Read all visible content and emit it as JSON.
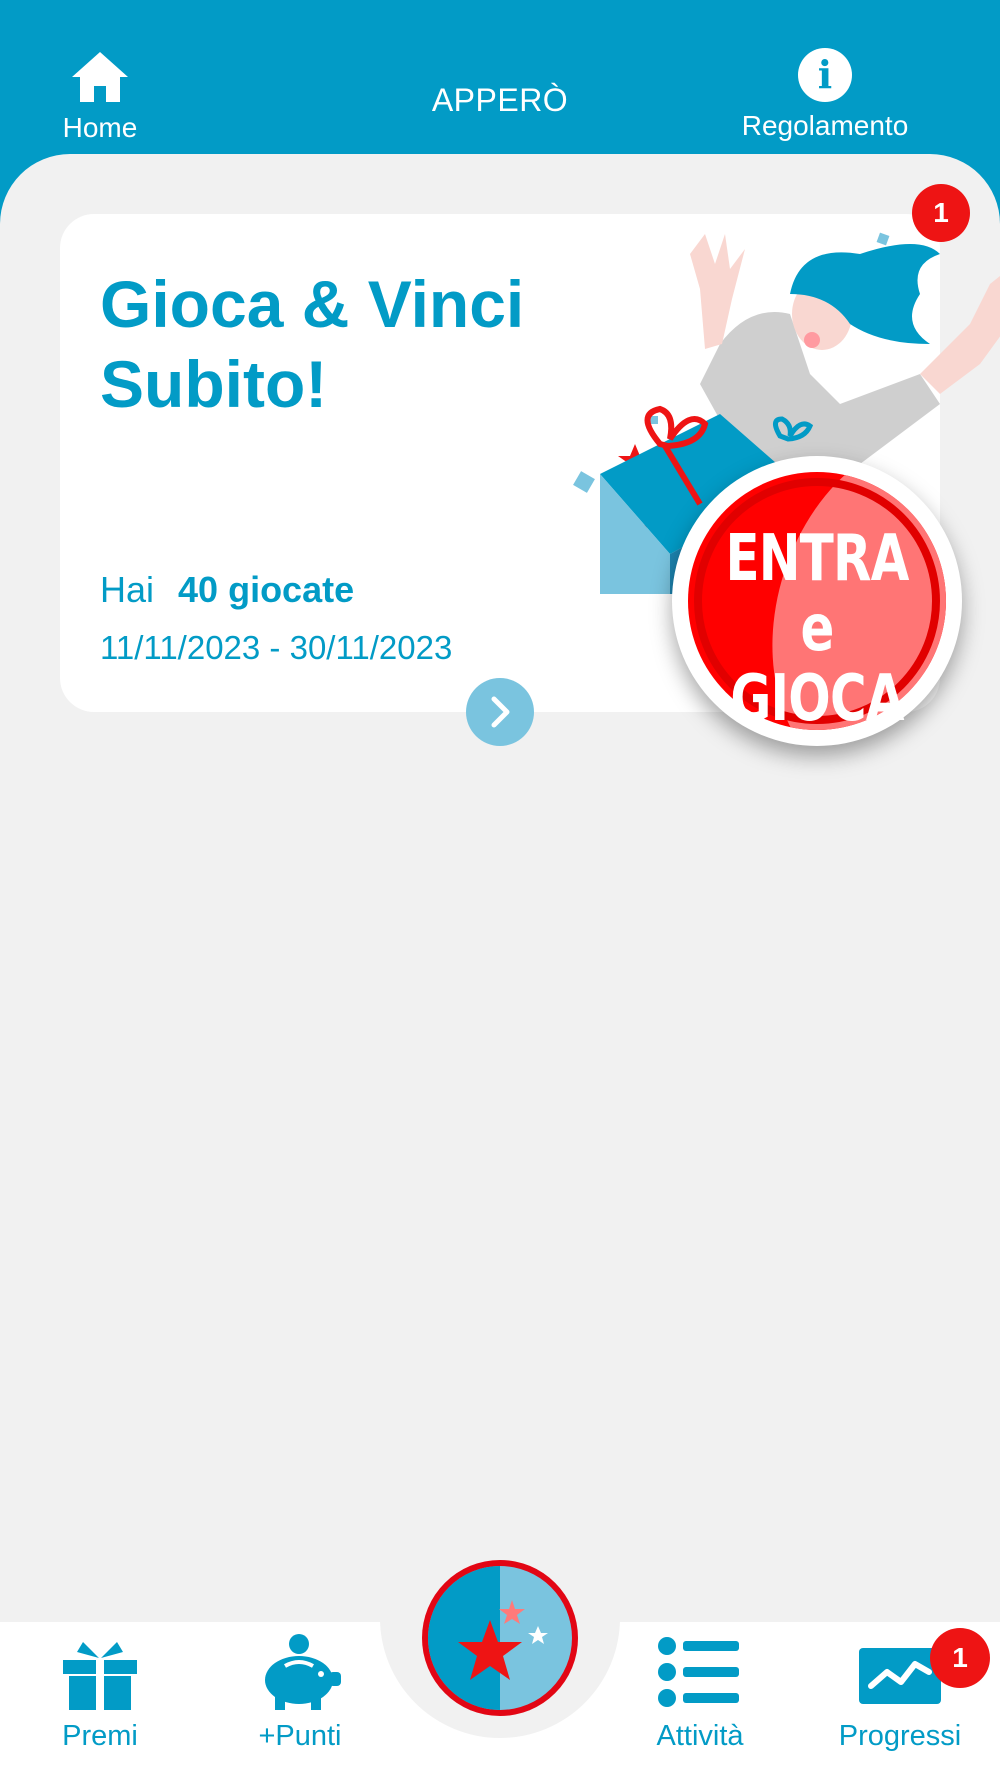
{
  "topbar": {
    "home_label": "Home",
    "title": "APPERÒ",
    "rules_label": "Regolamento",
    "info_glyph": "i"
  },
  "card": {
    "title": "Gioca & Vinci Subito!",
    "plays_prefix": "Hai",
    "plays_count": "40 giocate",
    "dates": "11/11/2023 - 30/11/2023",
    "badge_count": "1",
    "play_button_line1": "ENTRA e",
    "play_button_line2": "GIOCA"
  },
  "bottom_nav": {
    "items": [
      {
        "label": "Premi",
        "icon": "gift-icon"
      },
      {
        "label": "+Punti",
        "icon": "piggy-bank-icon"
      },
      {
        "label": "Attività",
        "icon": "list-icon"
      },
      {
        "label": "Progressi",
        "icon": "chart-icon",
        "badge": "1"
      }
    ],
    "center_icon": "stars-icon"
  },
  "colors": {
    "brand_blue": "#029bc6",
    "light_blue": "#7ac4df",
    "alert_red": "#ee1414",
    "background": "#f1f1f1"
  }
}
